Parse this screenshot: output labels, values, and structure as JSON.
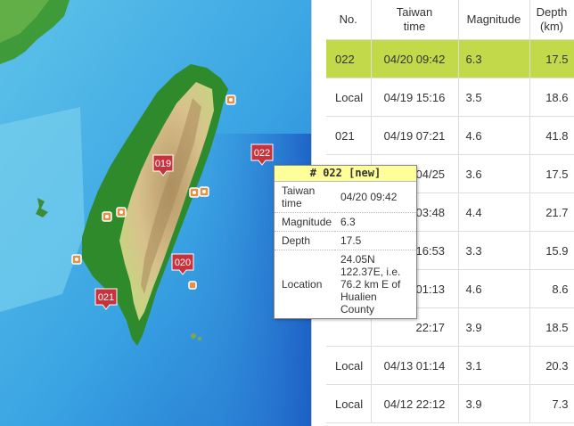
{
  "map": {
    "markers": [
      {
        "label": "019",
        "color": "#c6333d"
      },
      {
        "label": "020",
        "color": "#c6333d"
      },
      {
        "label": "021",
        "color": "#c6333d"
      },
      {
        "label": "022",
        "color": "#c6333d"
      }
    ]
  },
  "table": {
    "headers": {
      "no": "No.",
      "time_line1": "Taiwan",
      "time_line2": "time",
      "magnitude": "Magnitude",
      "depth_line1": "Depth",
      "depth_line2": "(km)"
    },
    "selected_color": "#c2d94a",
    "rows": [
      {
        "no": "022",
        "time": "04/20 09:42",
        "mag": "6.3",
        "depth": "17.5",
        "selected": true
      },
      {
        "no": "Local",
        "time": "04/19 15:16",
        "mag": "3.5",
        "depth": "18.6"
      },
      {
        "no": "021",
        "time": "04/19 07:21",
        "mag": "4.6",
        "depth": "41.8"
      },
      {
        "no": "",
        "time": "04/25",
        "mag": "3.6",
        "depth": "17.5"
      },
      {
        "no": "",
        "time": "03:48",
        "mag": "4.4",
        "depth": "21.7"
      },
      {
        "no": "",
        "time": "16:53",
        "mag": "3.3",
        "depth": "15.9"
      },
      {
        "no": "",
        "time": "01:13",
        "mag": "4.6",
        "depth": "8.6"
      },
      {
        "no": "",
        "time": "22:17",
        "mag": "3.9",
        "depth": "18.5"
      },
      {
        "no": "Local",
        "time": "04/13 01:14",
        "mag": "3.1",
        "depth": "20.3"
      },
      {
        "no": "Local",
        "time": "04/12 22:12",
        "mag": "3.9",
        "depth": "7.3"
      }
    ]
  },
  "popup": {
    "title": "# 022 [new]",
    "title_bg": "#ffff99",
    "rows": [
      {
        "key": "Taiwan time",
        "value": "04/20 09:42"
      },
      {
        "key": "Magnitude",
        "value": "6.3"
      },
      {
        "key": "Depth",
        "value": "17.5"
      },
      {
        "key": "Location",
        "value": "24.05N 122.37E, i.e. 76.2 km E of Hualien County"
      }
    ]
  }
}
